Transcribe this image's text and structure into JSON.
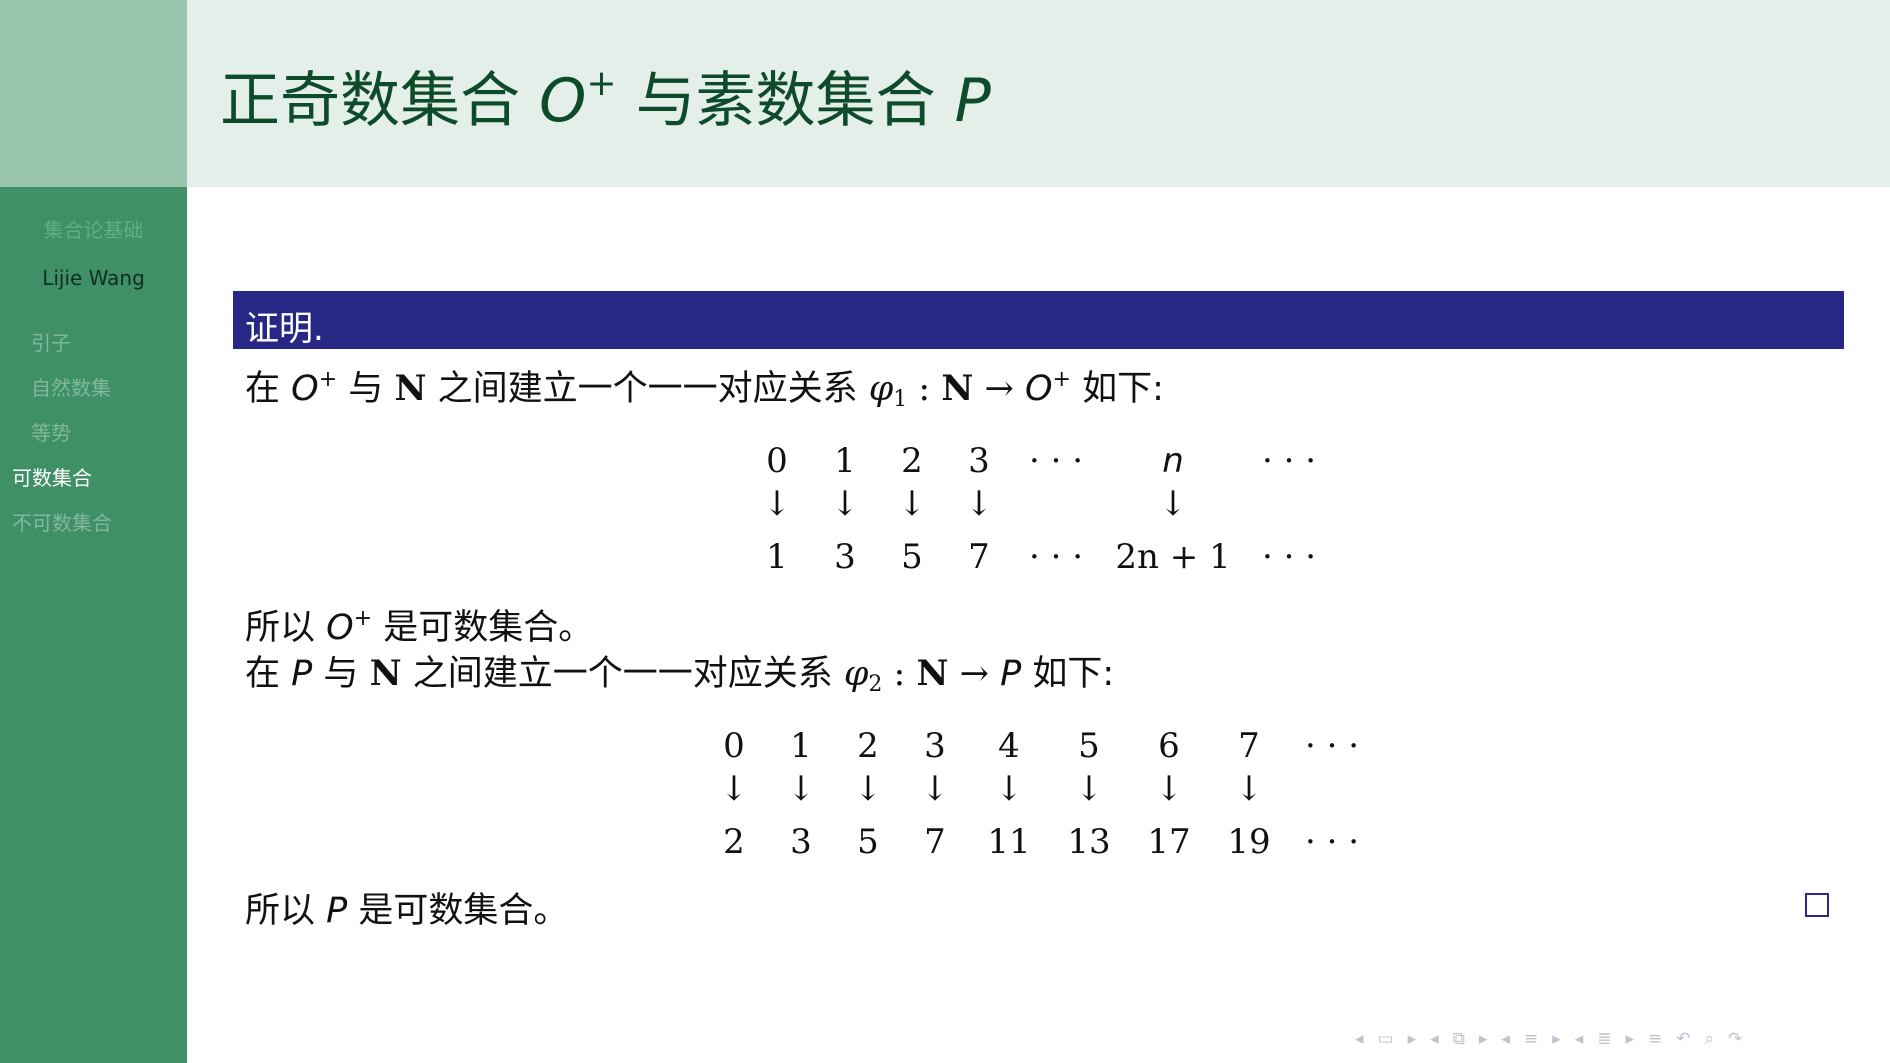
{
  "sidebar": {
    "title": "集合论基础",
    "author": "Lijie Wang",
    "items": [
      {
        "label": "引子"
      },
      {
        "label": "自然数集"
      },
      {
        "label": "等势"
      },
      {
        "label": "可数集合"
      },
      {
        "label": "不可数集合"
      }
    ]
  },
  "slide": {
    "title_part1": "正奇数集合",
    "title_sym1": "O",
    "title_sup": "+",
    "title_part2": "与素数集合",
    "title_sym2": "P"
  },
  "proof": {
    "label": "证明.",
    "line1": {
      "t1": "在",
      "sym_o": "O",
      "sup": "+",
      "t2": "与",
      "n": "N",
      "t3": "之间建立一个一一对应关系",
      "phi": "φ",
      "sub": "1",
      "colon": ":",
      "n2": "N",
      "arrow": "→",
      "sym_o2": "O",
      "sup2": "+",
      "t4": "如下:"
    },
    "table1": {
      "top": [
        "0",
        "1",
        "2",
        "3",
        "· · ·",
        "n",
        "· · ·"
      ],
      "bottom": [
        "1",
        "3",
        "5",
        "7",
        "· · ·",
        "2n + 1",
        "· · ·"
      ]
    },
    "line2": {
      "t1": "所以",
      "sym_o": "O",
      "sup": "+",
      "t2": "是可数集合。"
    },
    "line3": {
      "t1": "在",
      "sym_p": "P",
      "t2": "与",
      "n": "N",
      "t3": "之间建立一个一一对应关系",
      "phi": "φ",
      "sub": "2",
      "colon": ":",
      "n2": "N",
      "arrow": "→",
      "sym_p2": "P",
      "t4": "如下:"
    },
    "table2": {
      "top": [
        "0",
        "1",
        "2",
        "3",
        "4",
        "5",
        "6",
        "7",
        "· · ·"
      ],
      "bottom": [
        "2",
        "3",
        "5",
        "7",
        "11",
        "13",
        "17",
        "19",
        "· · ·"
      ]
    },
    "line4": {
      "t1": "所以",
      "sym_p": "P",
      "t2": "是可数集合。"
    },
    "arrow_glyph": "↓"
  },
  "colors": {
    "sidebar": "#3f8f67",
    "sidebar_top": "#98c4ae",
    "header": "#e3efe8",
    "title": "#0e4b2a",
    "proof_bar": "#272886"
  }
}
